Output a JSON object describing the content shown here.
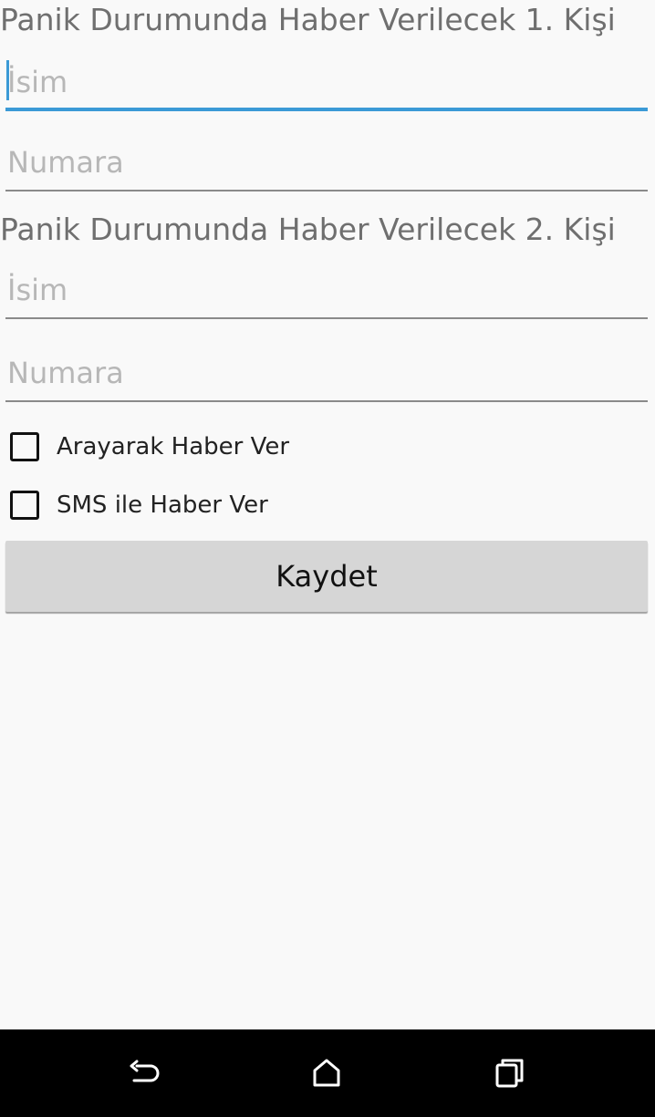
{
  "contact1": {
    "title": "Panik Durumunda Haber Verilecek 1. Kişi",
    "name_placeholder": "İsim",
    "number_placeholder": "Numara"
  },
  "contact2": {
    "title": "Panik Durumunda Haber Verilecek 2. Kişi",
    "name_placeholder": "İsim",
    "number_placeholder": "Numara"
  },
  "options": {
    "call_label": "Arayarak Haber Ver",
    "call_checked": false,
    "sms_label": "SMS ile Haber Ver",
    "sms_checked": false
  },
  "save_label": "Kaydet",
  "nav": {
    "icons": [
      "back-icon",
      "home-icon",
      "recents-icon"
    ]
  },
  "colors": {
    "accent": "#3b9ad6",
    "background": "#f9f9f9",
    "button": "#d6d6d6",
    "navbar": "#000000"
  }
}
